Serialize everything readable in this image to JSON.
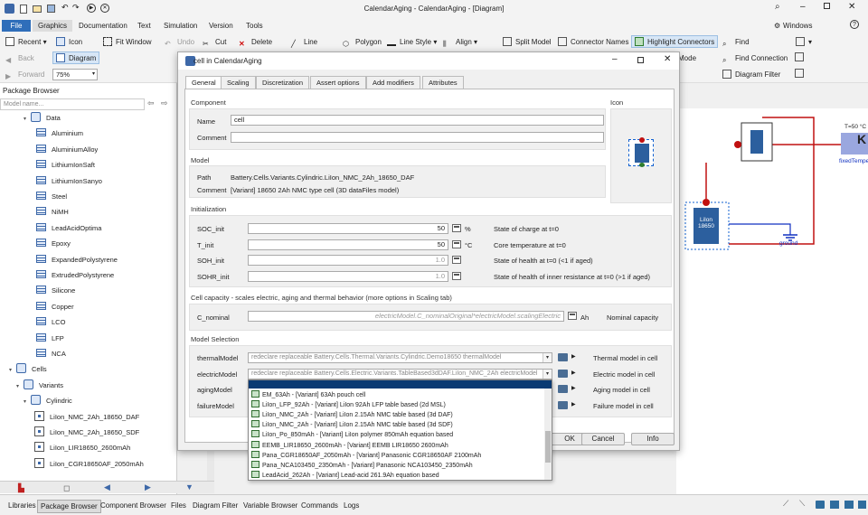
{
  "window": {
    "title": "CalendarAging - CalendarAging - [Diagram]"
  },
  "menu": [
    "File",
    "Graphics",
    "Documentation",
    "Text",
    "Simulation",
    "Version",
    "Tools"
  ],
  "topright": {
    "layout": "Windows"
  },
  "toolbar": {
    "recent": "Recent",
    "icon": "Icon",
    "fit_window": "Fit Window",
    "undo": "Undo",
    "cut": "Cut",
    "delete": "Delete",
    "line": "Line",
    "polygon": "Polygon",
    "line_style": "Line Style",
    "align": "Align",
    "split_model": "Split Model",
    "connector_names": "Connector Names",
    "highlight_connectors": "Highlight Connectors",
    "find": "Find",
    "back": "Back",
    "diagram": "Diagram",
    "mode": "Mode",
    "find_connection": "Find Connection",
    "forward": "Forward",
    "zoom": "75%",
    "diagram_filter": "Diagram Filter"
  },
  "package_browser": {
    "title": "Package Browser",
    "model_placeholder": "Model name...",
    "items": [
      {
        "label": "Data",
        "kind": "pkg"
      },
      {
        "label": "Aluminium",
        "kind": "table"
      },
      {
        "label": "AluminiumAlloy",
        "kind": "table"
      },
      {
        "label": "LithiumIonSaft",
        "kind": "table"
      },
      {
        "label": "LithiumIonSanyo",
        "kind": "table"
      },
      {
        "label": "Steel",
        "kind": "table"
      },
      {
        "label": "NiMH",
        "kind": "table"
      },
      {
        "label": "LeadAcidOptima",
        "kind": "table"
      },
      {
        "label": "Epoxy",
        "kind": "table"
      },
      {
        "label": "ExpandedPolystyrene",
        "kind": "table"
      },
      {
        "label": "ExtrudedPolystyrene",
        "kind": "table"
      },
      {
        "label": "Silicone",
        "kind": "table"
      },
      {
        "label": "Copper",
        "kind": "table"
      },
      {
        "label": "LCO",
        "kind": "table"
      },
      {
        "label": "LFP",
        "kind": "table"
      },
      {
        "label": "NCA",
        "kind": "table"
      },
      {
        "label": "Cells",
        "kind": "pkg"
      },
      {
        "label": "Variants",
        "kind": "pkg"
      },
      {
        "label": "Cylindric",
        "kind": "pkg"
      },
      {
        "label": "LiIon_NMC_2Ah_18650_DAF",
        "kind": "class"
      },
      {
        "label": "LiIon_NMC_2Ah_18650_SDF",
        "kind": "class"
      },
      {
        "label": "LiIon_LIR18650_2600mAh",
        "kind": "class"
      },
      {
        "label": "LiIon_CGR18650AF_2050mAh",
        "kind": "class"
      }
    ]
  },
  "dialog": {
    "title": "cell in CalendarAging",
    "tabs": [
      "General",
      "Scaling",
      "Discretization",
      "Assert options",
      "Add modifiers",
      "Attributes"
    ],
    "component_header": "Component",
    "icon_header": "Icon",
    "name_label": "Name",
    "name_value": "cell",
    "comment_label": "Comment",
    "comment_value": "",
    "model_header": "Model",
    "path_label": "Path",
    "path_value": "Battery.Cells.Variants.Cylindric.LiIon_NMC_2Ah_18650_DAF",
    "model_comment_label": "Comment",
    "model_comment_value": "[Variant] 18650 2Ah NMC type cell (3D dataFiles model)",
    "init_header": "Initialization",
    "params": [
      {
        "name": "SOC_init",
        "value": "50",
        "unit": "%",
        "desc": "State of charge at t=0"
      },
      {
        "name": "T_init",
        "value": "50",
        "unit": "°C",
        "desc": "Core temperature at t=0"
      },
      {
        "name": "SOH_init",
        "value": "1.0",
        "unit": "",
        "desc": "State of health at t=0 (<1 if aged)"
      },
      {
        "name": "SOHR_init",
        "value": "1.0",
        "unit": "",
        "desc": "State of health of inner resistance at t=0 (>1 if aged)"
      }
    ],
    "capacity_header": "Cell capacity - scales electric, aging and thermal behavior (more options in Scaling tab)",
    "cnominal_label": "C_nominal",
    "cnominal_value": "electricModel.C_nominalOriginal*electricModel.scalingElectric",
    "cnominal_unit": "Ah",
    "cnominal_desc": "Nominal capacity",
    "selection_header": "Model Selection",
    "selections": [
      {
        "name": "thermalModel",
        "value": "redeclare replaceable Battery.Cells.Thermal.Variants.Cylindric.Demo18650 thermalModel",
        "desc": "Thermal model in cell"
      },
      {
        "name": "electricModel",
        "value": "redeclare replaceable Battery.Cells.Electric.Variants.TableBased3dDAF.LiIon_NMC_2Ah electricModel",
        "desc": "Electric model in cell"
      },
      {
        "name": "agingModel",
        "value": "",
        "desc": "Aging model in cell"
      },
      {
        "name": "failureModel",
        "value": "",
        "desc": "Failure model in cell"
      }
    ],
    "ok": "OK",
    "cancel": "Cancel",
    "info": "Info"
  },
  "dropdown_items": [
    "EM_63Ah - [Variant] 63Ah pouch cell",
    "LiIon_LFP_92Ah - [Variant] LiIon 92Ah LFP table based (2d MSL)",
    "LiIon_NMC_2Ah - [Variant] LiIon 2.15Ah NMC table based (3d DAF)",
    "LiIon_NMC_2Ah - [Variant] LiIon 2.15Ah NMC table based (3d SDF)",
    "LiIon_Po_850mAh - [Variant] LiIon polymer 850mAh equation based",
    "EEMB_LIR18650_2600mAh - [Variant] EEMB LIR18650 2600mAh",
    "Pana_CGR18650AF_2050mAh - [Variant] Panasonic CGR18650AF 2100mAh",
    "Pana_NCA103450_2350mAh - [Variant] Panasonic NCA103450_2350mAh",
    "LeadAcid_262Ah - [Variant] Lead-acid 261.9Ah equation based"
  ],
  "diagram": {
    "cell_label": "LiIon\n18650",
    "temp_label": "T=50 °C",
    "fixed_temp": "fixedTempe",
    "ground": "ground",
    "k_label": "K"
  },
  "bottom_tabs": [
    "Libraries",
    "Package Browser",
    "Component Browser",
    "Files",
    "Diagram Filter",
    "Variable Browser",
    "Commands",
    "Logs"
  ]
}
